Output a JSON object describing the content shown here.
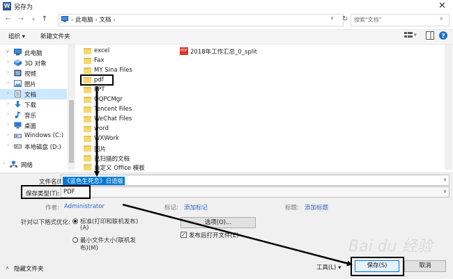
{
  "window": {
    "title": "另存为",
    "app_icon": "W",
    "close_glyph": "✕"
  },
  "address": {
    "path": [
      "此电脑",
      "文档"
    ],
    "search_placeholder": "搜索\"文档\""
  },
  "toolbar": {
    "organize": "组织 ▾",
    "new_folder": "新建文件夹"
  },
  "nav": {
    "items": [
      {
        "label": "此电脑",
        "icon": "computer-icon",
        "expanded": true
      },
      {
        "label": "3D 对象",
        "icon": "3d-objects-icon"
      },
      {
        "label": "视频",
        "icon": "video-icon"
      },
      {
        "label": "图片",
        "icon": "pictures-icon"
      },
      {
        "label": "文档",
        "icon": "documents-icon",
        "selected": true
      },
      {
        "label": "下载",
        "icon": "download-icon"
      },
      {
        "label": "音乐",
        "icon": "music-icon"
      },
      {
        "label": "桌面",
        "icon": "desktop-icon"
      },
      {
        "label": "Windows (C:)",
        "icon": "drive-icon"
      },
      {
        "label": "本地磁盘 (D:)",
        "icon": "drive-icon"
      },
      {
        "label": "网络",
        "icon": "network-icon"
      }
    ]
  },
  "files": {
    "column1": [
      "excel",
      "Fax",
      "MY Sina Files",
      "pdf",
      "PPT",
      "QQPCMgr",
      "Tencent Files",
      "WeChat Files",
      "word",
      "WXWork",
      "图片",
      "已扫描的文档",
      "自定义 Office 模板"
    ],
    "column2": [
      "2018年工作汇总_0_split"
    ]
  },
  "form": {
    "filename_label": "文件名(N):",
    "filename_value": "《蓝色生死恋》日语版",
    "filetype_label": "保存类型(T):",
    "filetype_value": "PDF",
    "author_label": "作者:",
    "author_value": "Administrator",
    "tags_label": "标记:",
    "tags_value": "添加标记",
    "title_label": "标题:",
    "title_value": "添加标题",
    "optimize_label": "针对以下格式优化:",
    "opt1_line1": "标准(打印和联机发布)",
    "opt1_line2": "(A)",
    "opt2_line1": "最小文件大小(联机发",
    "opt2_line2": "布)(M)",
    "options_button": "选项(O)...",
    "open_after_publish": "发布后打开文件(E)",
    "hide_folders": "隐藏文件夹",
    "tools": "工具(L)",
    "save": "保存(S)",
    "cancel": "取消"
  },
  "watermark": "Bai du 经验"
}
